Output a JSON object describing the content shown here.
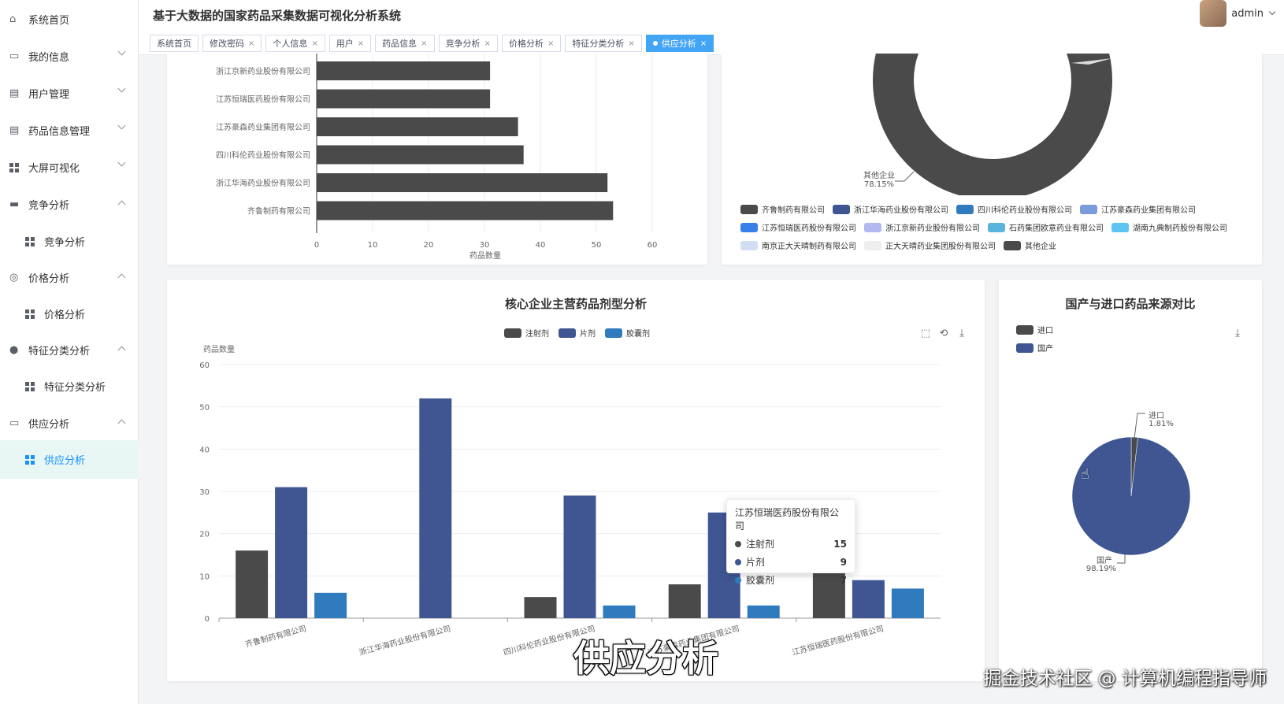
{
  "sidebar": {
    "items": [
      {
        "label": "系统首页",
        "icon": "home-icon",
        "caret": ""
      },
      {
        "label": "我的信息",
        "icon": "card-icon",
        "caret": "down"
      },
      {
        "label": "用户管理",
        "icon": "clipboard-icon",
        "caret": "down"
      },
      {
        "label": "药品信息管理",
        "icon": "clipboard-icon",
        "caret": "down"
      },
      {
        "label": "大屏可视化",
        "icon": "grid-icon",
        "caret": "down"
      },
      {
        "label": "竞争分析",
        "icon": "truck-icon",
        "caret": "up"
      },
      {
        "label": "竞争分析",
        "icon": "grid-icon",
        "caret": "",
        "sub": true
      },
      {
        "label": "价格分析",
        "icon": "circle-icon",
        "caret": "up"
      },
      {
        "label": "价格分析",
        "icon": "grid-icon",
        "caret": "",
        "sub": true
      },
      {
        "label": "特征分类分析",
        "icon": "user-icon",
        "caret": "up"
      },
      {
        "label": "特征分类分析",
        "icon": "grid-icon",
        "caret": "",
        "sub": true
      },
      {
        "label": "供应分析",
        "icon": "card-icon",
        "caret": "up"
      },
      {
        "label": "供应分析",
        "icon": "grid-icon",
        "caret": "",
        "sub": true,
        "active": true
      }
    ]
  },
  "header": {
    "title": "基于大数据的国家药品采集数据可视化分析系统",
    "user": "admin"
  },
  "tabs": [
    {
      "label": "系统首页",
      "closable": false
    },
    {
      "label": "修改密码",
      "closable": true
    },
    {
      "label": "个人信息",
      "closable": true
    },
    {
      "label": "用户",
      "closable": true
    },
    {
      "label": "药品信息",
      "closable": true
    },
    {
      "label": "竞争分析",
      "closable": true
    },
    {
      "label": "价格分析",
      "closable": true
    },
    {
      "label": "特征分类分析",
      "closable": true
    },
    {
      "label": "供应分析",
      "closable": true,
      "active": true
    }
  ],
  "colors": {
    "dark": "#4a4a4a",
    "navy": "#3f5693",
    "blue": "#2f7bbd",
    "accent": "#1890ff"
  },
  "chart_data": [
    {
      "type": "bar",
      "orientation": "horizontal",
      "categories": [
        "浙江京新药业股份有限公司",
        "江苏恒瑞医药股份有限公司",
        "江苏豪森药业集团有限公司",
        "四川科伦药业股份有限公司",
        "浙江华海药业股份有限公司",
        "齐鲁制药有限公司"
      ],
      "values": [
        31,
        31,
        36,
        37,
        52,
        53
      ],
      "xlabel": "药品数量",
      "xlim": [
        0,
        60
      ],
      "xticks": [
        0,
        10,
        20,
        30,
        40,
        50,
        60
      ]
    },
    {
      "type": "pie",
      "style": "donut",
      "labels": [
        "其他企业"
      ],
      "label_text": "其他企业",
      "label_pct": "78.15%",
      "legend": [
        "齐鲁制药有限公司",
        "浙江华海药业股份有限公司",
        "四川科伦药业股份有限公司",
        "江苏豪森药业集团有限公司",
        "江苏恒瑞医药股份有限公司",
        "浙江京新药业股份有限公司",
        "石药集团欧意药业有限公司",
        "湖南九典制药股份有限公司",
        "南京正大天晴制药有限公司",
        "正大天晴药业集团股份有限公司",
        "其他企业"
      ],
      "legend_colors": [
        "#4a4a4a",
        "#3f5693",
        "#2f7bbd",
        "#7b9bdc",
        "#3a7fe8",
        "#b3b8f0",
        "#5ab4dc",
        "#5ec3f0",
        "#d3def5",
        "#eeeeee",
        "#4a4a4a"
      ]
    },
    {
      "type": "bar",
      "title": "核心企业主营药品剂型分析",
      "ylabel": "药品数量",
      "ylim": [
        0,
        60
      ],
      "yticks": [
        0,
        10,
        20,
        30,
        40,
        50,
        60
      ],
      "categories": [
        "齐鲁制药有限公司",
        "浙江华海药业股份有限公司",
        "四川科伦药业股份有限公司",
        "江苏豪森药业集团有限公司",
        "江苏恒瑞医药股份有限公司"
      ],
      "series": [
        {
          "name": "注射剂",
          "values": [
            16,
            0,
            5,
            8,
            15
          ],
          "color": "#4a4a4a"
        },
        {
          "name": "片剂",
          "values": [
            31,
            52,
            29,
            25,
            9
          ],
          "color": "#3f5693"
        },
        {
          "name": "胶囊剂",
          "values": [
            6,
            0,
            3,
            3,
            7
          ],
          "color": "#2f7bbd"
        }
      ],
      "tooltip": {
        "title": "江苏恒瑞医药股份有限公司",
        "rows": [
          {
            "name": "注射剂",
            "value": "15"
          },
          {
            "name": "片剂",
            "value": "9"
          },
          {
            "name": "胶囊剂",
            "value": "7"
          }
        ]
      }
    },
    {
      "type": "pie",
      "title": "国产与进口药品来源对比",
      "labels": [
        "进口",
        "国产"
      ],
      "values": [
        1.81,
        98.19
      ],
      "pct_labels": [
        "1.81%",
        "98.19%"
      ],
      "colors": [
        "#4a4a4a",
        "#3f5693"
      ]
    }
  ],
  "overlay": {
    "subtitle": "供应分析",
    "watermark": "掘金技术社区 @ 计算机编程指导师"
  }
}
